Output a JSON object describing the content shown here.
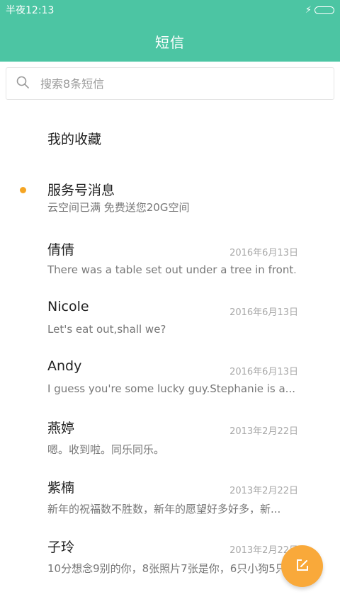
{
  "status_bar": {
    "time": "半夜12:13",
    "charging_icon": "bolt-icon",
    "battery_icon": "battery-icon"
  },
  "header": {
    "title": "短信"
  },
  "search": {
    "placeholder": "搜索8条短信",
    "icon": "search-icon"
  },
  "conversations": [
    {
      "name": "我的收藏",
      "date": "",
      "preview": "",
      "unread": false
    },
    {
      "name": "服务号消息",
      "date": "",
      "preview": "云空间已满 免费送您20G空间",
      "unread": true
    },
    {
      "name": "倩倩",
      "date": "2016年6月13日",
      "preview": "There was a table set out under a tree in front...",
      "unread": false
    },
    {
      "name": "Nicole",
      "date": "2016年6月13日",
      "preview": "Let's eat out,shall we?",
      "unread": false
    },
    {
      "name": "Andy",
      "date": "2016年6月13日",
      "preview": "I guess you're some lucky guy.Stephanie is a...",
      "unread": false
    },
    {
      "name": "燕婷",
      "date": "2013年2月22日",
      "preview": "嗯。收到啦。同乐同乐。",
      "unread": false
    },
    {
      "name": "紫楠",
      "date": "2013年2月22日",
      "preview": "新年的祝福数不胜数，新年的愿望好多好多，新...",
      "unread": false
    },
    {
      "name": "子玲",
      "date": "2013年2月22日",
      "preview": "10分想念9别的你，8张照片7张是你，6只小狗5只",
      "unread": false
    }
  ],
  "compose_button": {
    "icon": "compose-icon"
  },
  "colors": {
    "header_bg": "#4cc5a3",
    "unread_dot": "#f5a523",
    "fab_bg": "#f9a93a"
  }
}
